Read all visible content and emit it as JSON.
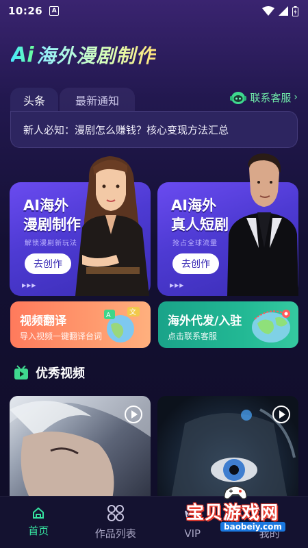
{
  "status": {
    "time": "10:26",
    "notif_letter": "A"
  },
  "header": {
    "ai_logo": "Ai",
    "title": "海外漫剧制作"
  },
  "notice": {
    "tabs": [
      {
        "label": "头条"
      },
      {
        "label": "最新通知"
      }
    ],
    "support_label": "联系客服",
    "headline": "新人必知：漫剧怎么赚钱？核心变现方法汇总"
  },
  "features": [
    {
      "title_line1": "AI海外",
      "title_line2": "漫剧制作",
      "subtitle": "解锁漫剧新玩法",
      "button": "去创作"
    },
    {
      "title_line1": "AI海外",
      "title_line2": "真人短剧",
      "subtitle": "抢占全球流量",
      "button": "去创作"
    }
  ],
  "quick_cards": [
    {
      "title": "视频翻译",
      "subtitle": "导入视频一键翻译台词"
    },
    {
      "title": "海外代发/入驻",
      "subtitle": "点击联系客服"
    }
  ],
  "section": {
    "title": "优秀视频"
  },
  "nav": [
    {
      "label": "首页",
      "icon": "home-icon"
    },
    {
      "label": "作品列表",
      "icon": "grid-icon"
    },
    {
      "label": "VIP",
      "icon": "vip-icon"
    },
    {
      "label": "我的",
      "icon": "profile-icon"
    }
  ],
  "watermark": {
    "text": "宝贝游戏网",
    "url": "baobeiy.com"
  },
  "colors": {
    "accent": "#36e3a0",
    "card_purple": "#4d3ad2",
    "card_orange": "#ff8a64",
    "card_green": "#22b894"
  }
}
